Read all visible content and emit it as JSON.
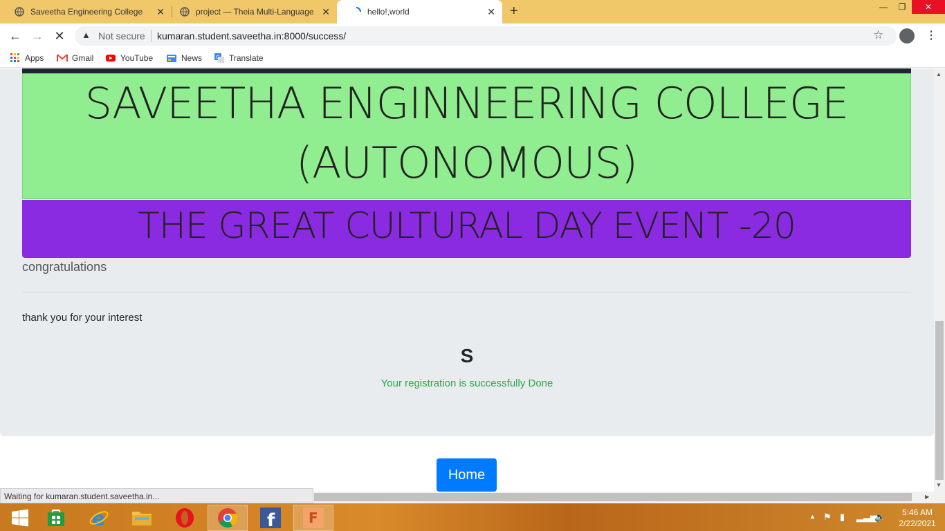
{
  "browser": {
    "tabs": [
      {
        "title": "Saveetha Engineering College",
        "active": false
      },
      {
        "title": "project — Theia Multi-Language",
        "active": false
      },
      {
        "title": "hello!,world",
        "active": true
      }
    ],
    "url_security": "Not secure",
    "url": "kumaran.student.saveetha.in:8000/success/",
    "bookmarks": [
      "Apps",
      "Gmail",
      "YouTube",
      "News",
      "Translate"
    ],
    "status_text": "Waiting for kumaran.student.saveetha.in..."
  },
  "page": {
    "college_line1": "SAVEETHA ENGINNEERING COLLEGE",
    "college_line2": "(AUTONOMOUS)",
    "event_title": "THE GREAT CULTURAL DAY EVENT -20",
    "congrats": "congratulations",
    "thanks": "thank you for your interest",
    "name_letter": "S",
    "success_msg": "Your registration is successfully Done",
    "home_button": "Home",
    "colors": {
      "college_bg": "#90ee90",
      "event_bg": "#8a2be2",
      "success": "#28a745",
      "button": "#007bff"
    }
  },
  "taskbar": {
    "apps": [
      "start-icon",
      "store-icon",
      "ie-icon",
      "file-explorer-icon",
      "opera-icon",
      "chrome-icon",
      "facebook-icon",
      "fusion360-icon"
    ],
    "time": "5:46 AM",
    "date": "2/22/2021"
  }
}
